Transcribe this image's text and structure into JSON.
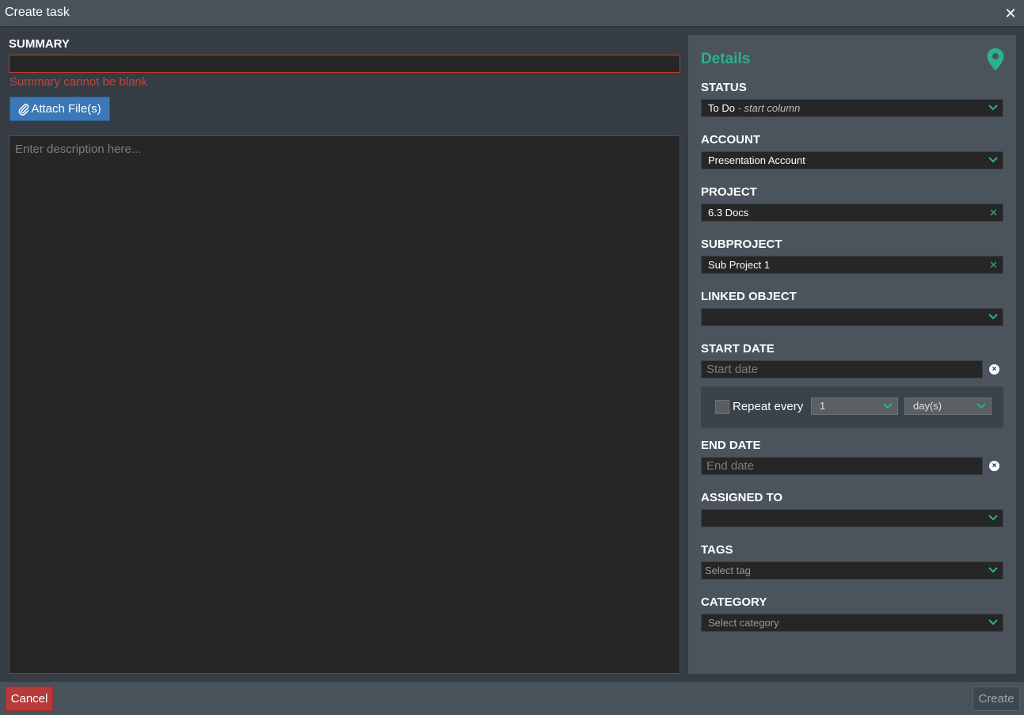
{
  "window": {
    "title": "Create task",
    "close_icon": "close-icon"
  },
  "summary": {
    "label": "SUMMARY",
    "value": "",
    "error": "Summary cannot be blank"
  },
  "attach": {
    "label": "Attach File(s)",
    "icon": "paperclip-icon"
  },
  "description": {
    "placeholder": "Enter description here..."
  },
  "details": {
    "title": "Details",
    "icon": "map-pin-icon",
    "status": {
      "label": "STATUS",
      "value": "To Do",
      "hint": "- start column"
    },
    "account": {
      "label": "ACCOUNT",
      "value": "Presentation Account"
    },
    "project": {
      "label": "PROJECT",
      "value": "6.3 Docs"
    },
    "subproject": {
      "label": "SUBPROJECT",
      "value": "Sub Project 1"
    },
    "linked_object": {
      "label": "LINKED OBJECT",
      "value": ""
    },
    "start_date": {
      "label": "START DATE",
      "placeholder": "Start date"
    },
    "repeat": {
      "label": "Repeat every",
      "count": "1",
      "unit": "day(s)",
      "checked": false
    },
    "end_date": {
      "label": "END DATE",
      "placeholder": "End date"
    },
    "assigned_to": {
      "label": "ASSIGNED TO",
      "value": ""
    },
    "tags": {
      "label": "TAGS",
      "placeholder": "Select tag"
    },
    "category": {
      "label": "CATEGORY",
      "placeholder": "Select category"
    }
  },
  "footer": {
    "cancel": "Cancel",
    "create": "Create"
  },
  "colors": {
    "accent": "#2bb090",
    "error": "#c0453f",
    "primary": "#3b78b5",
    "danger": "#b83b3b"
  }
}
